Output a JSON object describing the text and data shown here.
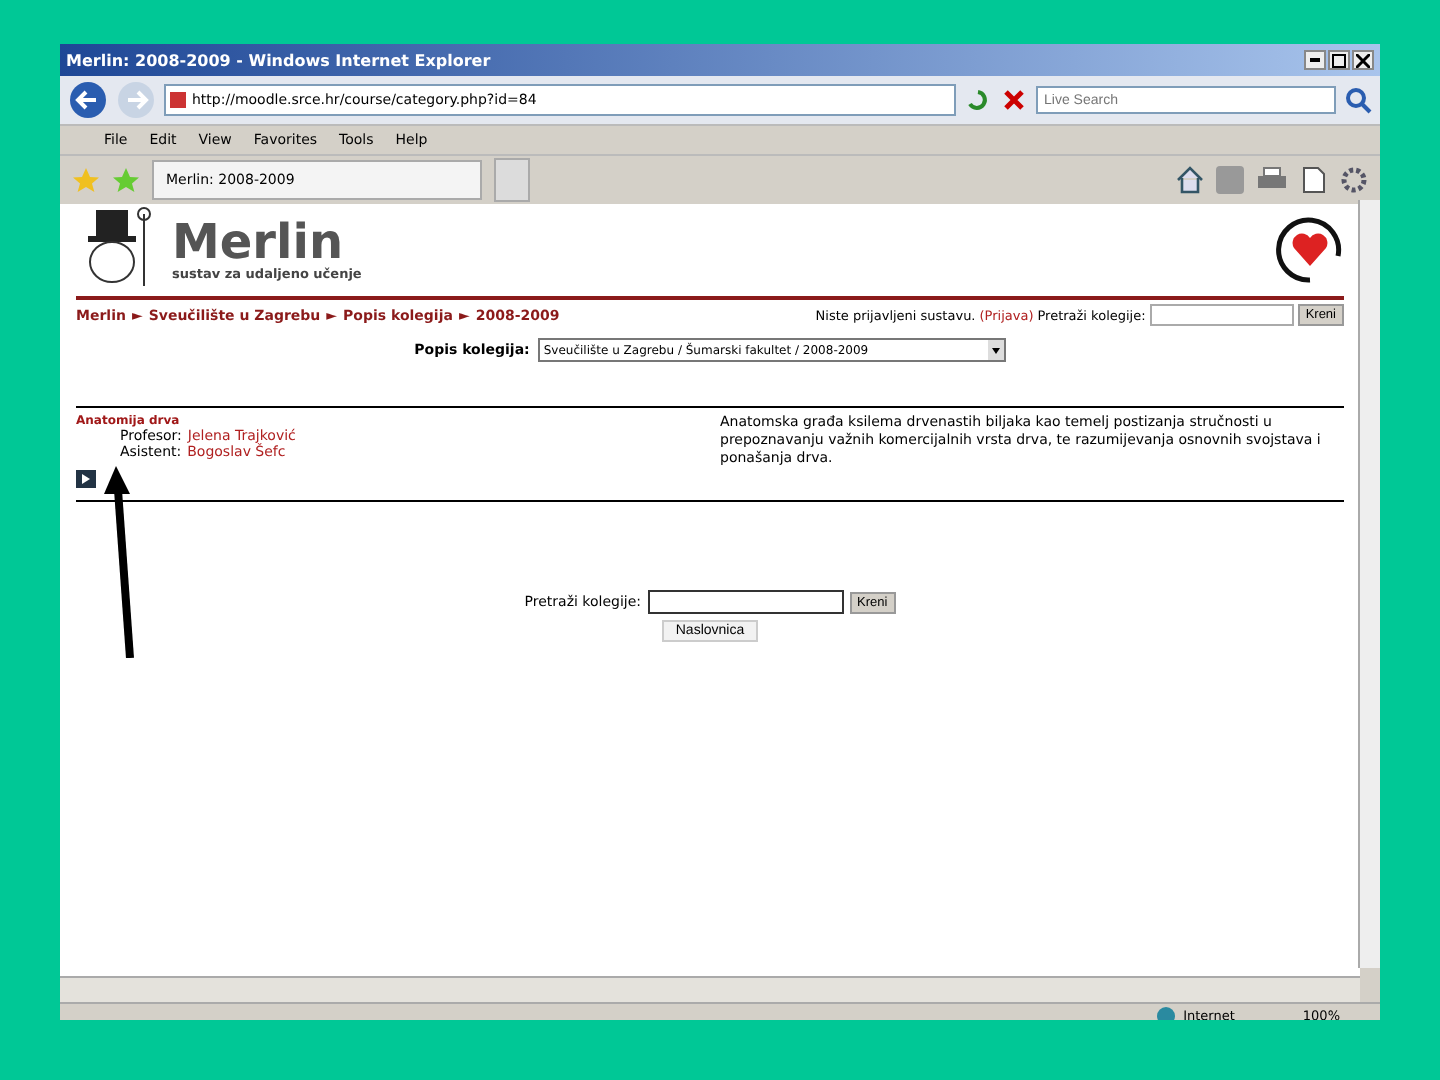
{
  "window": {
    "title": "Merlin: 2008-2009 - Windows Internet Explorer"
  },
  "address_bar": {
    "url": "http://moodle.srce.hr/course/category.php?id=84",
    "search_placeholder": "Live Search"
  },
  "menu": [
    "File",
    "Edit",
    "View",
    "Favorites",
    "Tools",
    "Help"
  ],
  "tabs": [
    {
      "label": "Merlin: 2008-2009",
      "selected": true
    }
  ],
  "page": {
    "logo": "Merlin",
    "tagline": "sustav za udaljeno učenje",
    "breadcrumb": [
      "Merlin",
      "Sveučilište u Zagrebu",
      "Popis kolegija",
      "2008-2009"
    ],
    "breadcrumb_separator": "►",
    "login_note": "Niste prijavljeni sustavu.",
    "login_link": "(Prijava)",
    "top_search": {
      "label": "Pretraži kolegije:",
      "button": "Kreni"
    },
    "category": {
      "label": "Popis kolegija:",
      "value": "Sveučilište u Zagrebu / Šumarski fakultet / 2008-2009"
    },
    "course": {
      "name": "Anatomija drva",
      "teachers": [
        {
          "role": "Profesor:",
          "name": "Jelena Trajković"
        },
        {
          "role": "Asistent:",
          "name": "Bogoslav Šefc"
        }
      ],
      "summary": "Anatomska građa ksilema drvenastih biljaka kao temelj postizanja stručnosti u prepoznavanju važnih komercijalnih vrsta drva, te razumijevanja osnovnih svojstava i ponašanja drva."
    },
    "bottom_search": {
      "label": "Pretraži kolegije:",
      "button": "Kreni"
    },
    "home_button": "Naslovnica"
  },
  "status_bar": {
    "zone": "Internet",
    "zoom": "100%"
  }
}
